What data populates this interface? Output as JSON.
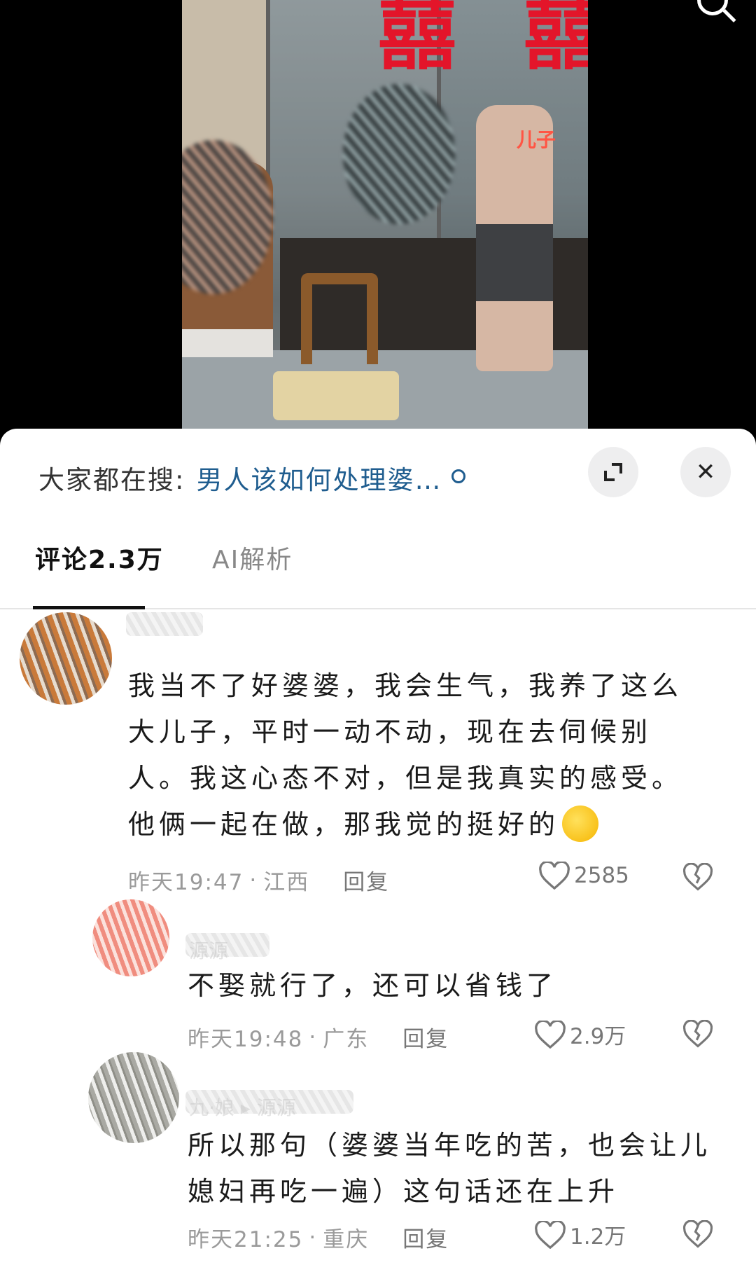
{
  "video": {
    "overlay_label": "儿子",
    "decor_char": "囍"
  },
  "search_bar": {
    "prefix": "大家都在搜:",
    "term": "男人该如何处理婆…"
  },
  "tabs": [
    {
      "label": "评论2.3万",
      "active": true
    },
    {
      "label": "AI解析",
      "active": false
    }
  ],
  "comments": [
    {
      "text_lines": [
        "我当不了好婆婆，我会生气，我养了这么",
        "大儿子，平时一动不动，现在去伺候别",
        "人。我这心态不对，但是我真实的感受。",
        "他俩一起在做，那我觉的挺好的"
      ],
      "time": "昨天19:47",
      "location": "江西",
      "reply_label": "回复",
      "likes": "2585"
    },
    {
      "username": "源源",
      "text_lines": [
        "不娶就行了，还可以省钱了"
      ],
      "time": "昨天19:48",
      "location": "广东",
      "reply_label": "回复",
      "likes": "2.9万"
    },
    {
      "username": "九·娘 ▸ 源源",
      "text_lines": [
        "所以那句（婆婆当年吃的苦，也会让儿",
        "媳妇再吃一遍）这句话还在上升"
      ],
      "time": "昨天21:25",
      "location": "重庆",
      "reply_label": "回复",
      "likes": "1.2万"
    }
  ],
  "colors": {
    "accent_link": "#1f5d8f",
    "decor_red": "#e3152a",
    "text_primary": "#1a1a1a",
    "text_meta": "#9a9a9a"
  },
  "icons": [
    "search-icon",
    "expand-icon",
    "close-icon",
    "heart-icon",
    "dislike-icon"
  ]
}
